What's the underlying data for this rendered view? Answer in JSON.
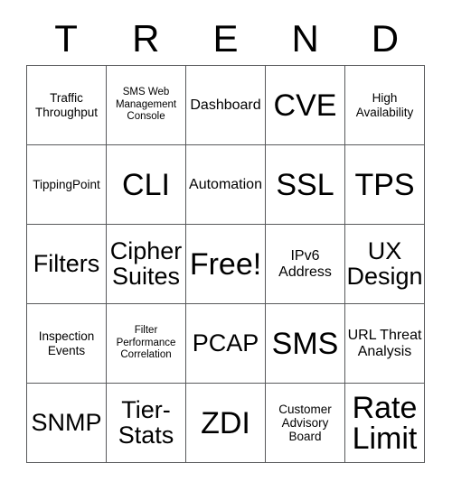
{
  "card": {
    "title_letters": [
      "T",
      "R",
      "E",
      "N",
      "D"
    ],
    "rows": [
      [
        {
          "label": "Traffic Throughput",
          "size": "s"
        },
        {
          "label": "SMS Web Management Console",
          "size": "xs"
        },
        {
          "label": "Dashboard",
          "size": "m"
        },
        {
          "label": "CVE",
          "size": "xxl"
        },
        {
          "label": "High Availability",
          "size": "s"
        }
      ],
      [
        {
          "label": "TippingPoint",
          "size": "s"
        },
        {
          "label": "CLI",
          "size": "xxl"
        },
        {
          "label": "Automation",
          "size": "m"
        },
        {
          "label": "SSL",
          "size": "xxl"
        },
        {
          "label": "TPS",
          "size": "xxl"
        }
      ],
      [
        {
          "label": "Filters",
          "size": "xl"
        },
        {
          "label": "Cipher Suites",
          "size": "xl"
        },
        {
          "label": "Free!",
          "size": "xxl"
        },
        {
          "label": "IPv6 Address",
          "size": "m"
        },
        {
          "label": "UX Design",
          "size": "xl"
        }
      ],
      [
        {
          "label": "Inspection Events",
          "size": "s"
        },
        {
          "label": "Filter Performance Correlation",
          "size": "xs"
        },
        {
          "label": "PCAP",
          "size": "xl"
        },
        {
          "label": "SMS",
          "size": "xxl"
        },
        {
          "label": "URL Threat Analysis",
          "size": "m"
        }
      ],
      [
        {
          "label": "SNMP",
          "size": "xl"
        },
        {
          "label": "Tier-Stats",
          "size": "xl"
        },
        {
          "label": "ZDI",
          "size": "xxl"
        },
        {
          "label": "Customer Advisory Board",
          "size": "s"
        },
        {
          "label": "Rate Limit",
          "size": "xxl"
        }
      ]
    ]
  },
  "colors": {
    "grid_line": "#58595b",
    "text": "#000000",
    "background": "#ffffff"
  }
}
